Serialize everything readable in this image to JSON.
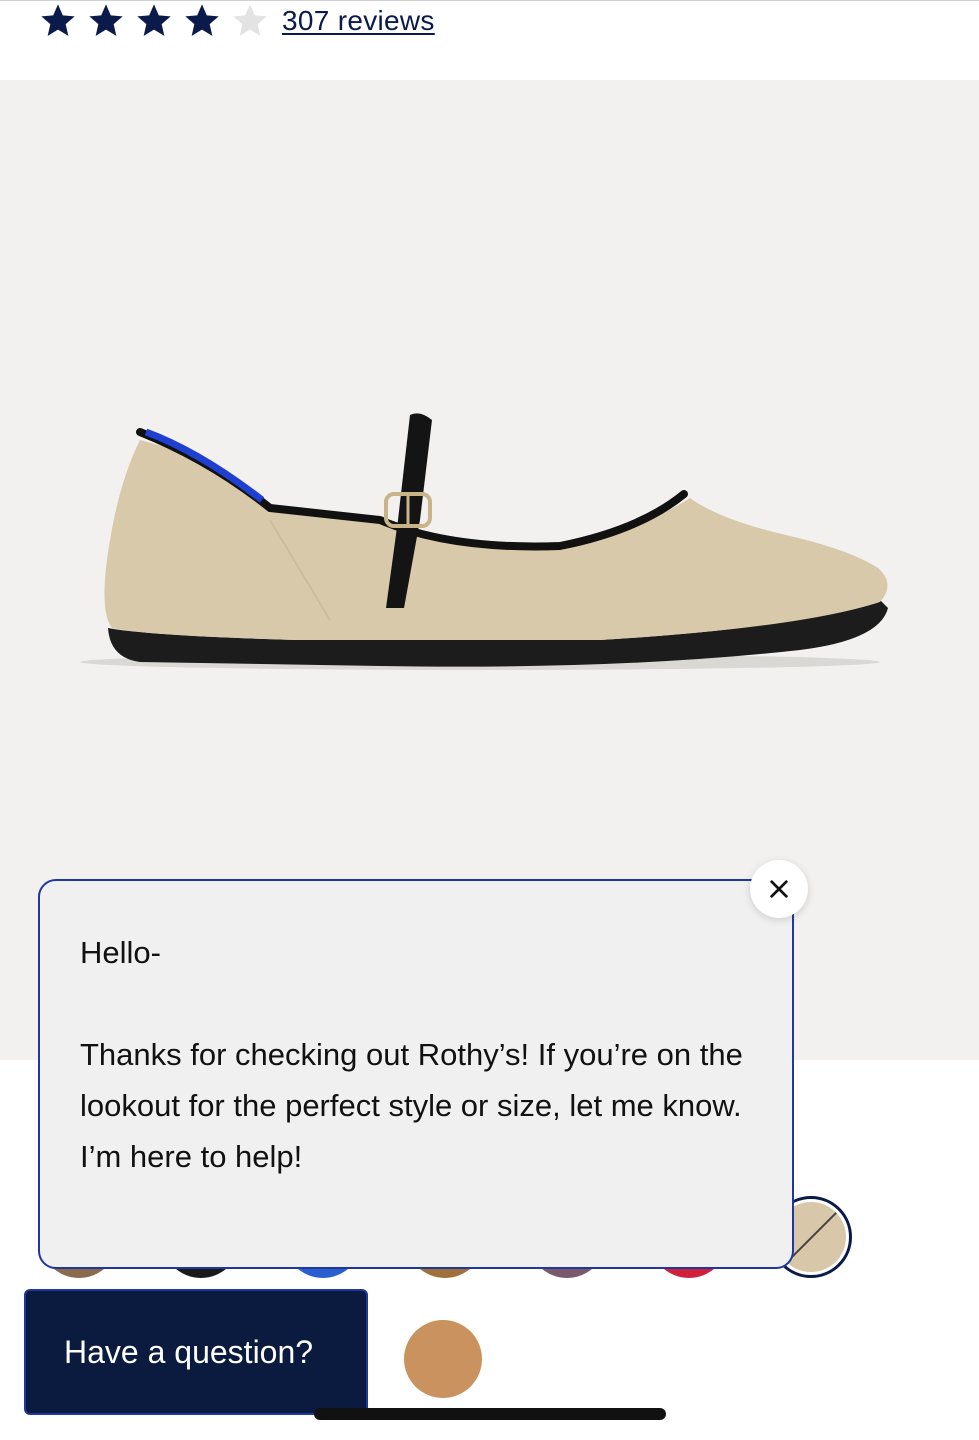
{
  "rating": {
    "stars_filled": 4,
    "stars_total": 5,
    "reviews_label": "307 reviews",
    "star_color": "#0a1a4a",
    "star_empty_color": "#e3e3e3"
  },
  "product_image": {
    "background": "#f2f1ef",
    "shoe_color": "#d8c9aa",
    "trim_color": "#111111",
    "heel_accent_color": "#1f3fd0"
  },
  "swatches": {
    "colors": [
      "#8a6a4a",
      "#1a1a1a",
      "#2a5fd0",
      "#a0703a",
      "#7a5a6a",
      "#d0203a",
      "#c9925e"
    ],
    "selected_color": "#d8c7a8"
  },
  "chat": {
    "greeting": "Hello-",
    "message": "Thanks for checking out Rothy’s! If you’re on the lookout for the perfect style or size, let me know. I’m here to help!",
    "close_icon": "close-icon",
    "border_color": "#20379d"
  },
  "question_button": {
    "label": "Have a question?",
    "background": "#0b1a3f"
  }
}
